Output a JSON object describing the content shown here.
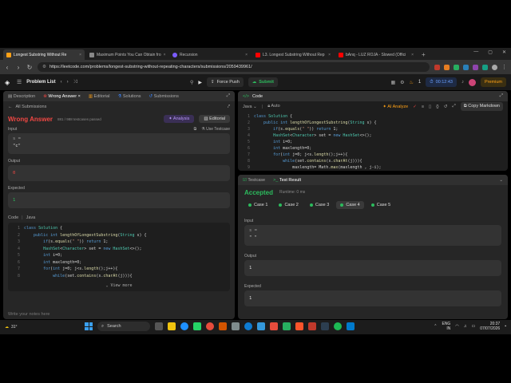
{
  "browser": {
    "tabs": [
      {
        "label": "Longest Substring Without Re",
        "active": true,
        "color": "#ffa116"
      },
      {
        "label": "Maximum Points You Can Obtain fro",
        "active": false,
        "color": "#888888"
      },
      {
        "label": "Recursion",
        "active": false,
        "color": "#7b5cff"
      },
      {
        "label": "L3. Longest Substring Without Rep",
        "active": false,
        "color": "#ff0000"
      },
      {
        "label": "bAnq - LUZ ROJA - Slowed (Offici",
        "active": false,
        "color": "#ff0000"
      }
    ],
    "new_tab": "+",
    "url": "https://leetcode.com/problems/longest-substring-without-repeating-characters/submissions/2059439961/"
  },
  "header": {
    "problem_list": "Problem List",
    "force_push": "Force Push",
    "submit": "Submit",
    "timer": "00:12:43",
    "fire_count": "1",
    "premium": "Premium"
  },
  "left": {
    "tabs": [
      "Description",
      "Wrong Answer",
      "Editorial",
      "Solutions",
      "Submissions"
    ],
    "all_submissions": "All Submissions",
    "status": "Wrong Answer",
    "passed": "881 / 988 testcases passed",
    "analysis": "Analysis",
    "editorial": "Editorial",
    "input_label": "Input",
    "use_testcase": "Use Testcase",
    "input_var": "s =",
    "input_val": "\"c\"",
    "output_label": "Output",
    "output_val": "0",
    "expected_label": "Expected",
    "expected_val": "1",
    "code_label": "Code",
    "code_lang": "Java",
    "view_more": "View more",
    "notes_placeholder": "Write your notes here"
  },
  "code_panel": {
    "title": "Code",
    "lang": "Java",
    "auto": "Auto",
    "ai_analyze": "AI Analyze",
    "copy_markdown": "Copy Markdown"
  },
  "result": {
    "tabs": [
      "Testcase",
      "Test Result"
    ],
    "status": "Accepted",
    "runtime": "Runtime: 0 ms",
    "cases": [
      "Case 1",
      "Case 2",
      "Case 3",
      "Case 4",
      "Case 5"
    ],
    "active_case": 3,
    "input_label": "Input",
    "input_var": "s =",
    "input_val": "\" \"",
    "output_label": "Output",
    "output_val": "1",
    "expected_label": "Expected",
    "expected_val": "1"
  },
  "taskbar": {
    "temp": "31°",
    "search": "Search",
    "lang": "ENG",
    "region": "IN",
    "time": "20:37",
    "date": "07/07/2026"
  },
  "colors": {
    "wrong": "#ef4743",
    "accepted": "#2cbb5d",
    "accent": "#ffa116"
  }
}
